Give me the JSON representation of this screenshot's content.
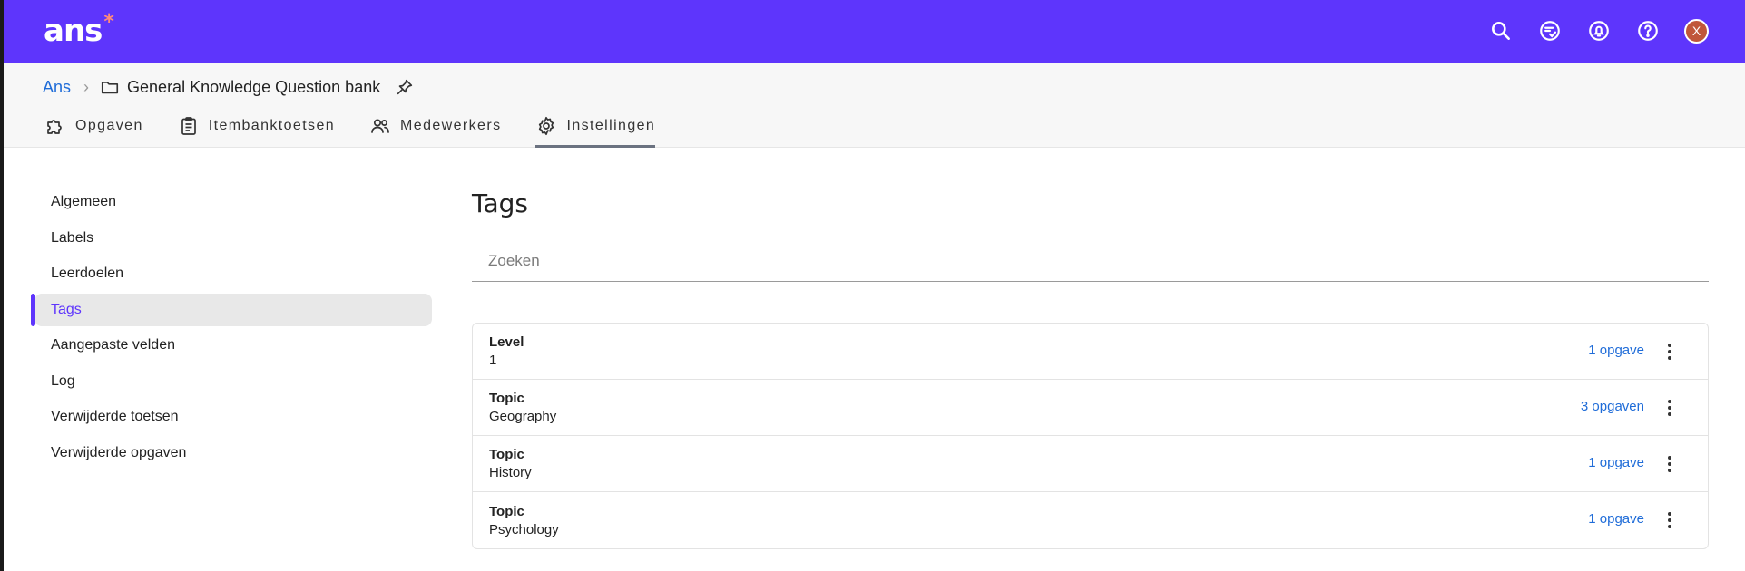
{
  "app": {
    "logo_text": "ans",
    "logo_star": "*",
    "avatar_initial": "X"
  },
  "icons": {
    "top": [
      "search-icon",
      "feedback-icon",
      "notification-icon",
      "help-icon"
    ],
    "tabs": [
      "puzzle-icon",
      "clipboard-icon",
      "people-icon",
      "gear-icon"
    ]
  },
  "breadcrumb": {
    "root": "Ans",
    "title": "General Knowledge Question bank"
  },
  "tabs": [
    {
      "label": "Opgaven",
      "icon": "puzzle-icon"
    },
    {
      "label": "Itembanktoetsen",
      "icon": "clipboard-icon"
    },
    {
      "label": "Medewerkers",
      "icon": "people-icon"
    },
    {
      "label": "Instellingen",
      "icon": "gear-icon",
      "active": true
    }
  ],
  "sidebar": {
    "items": [
      {
        "label": "Algemeen"
      },
      {
        "label": "Labels"
      },
      {
        "label": "Leerdoelen"
      },
      {
        "label": "Tags",
        "active": true
      },
      {
        "label": "Aangepaste velden"
      },
      {
        "label": "Log"
      },
      {
        "label": "Verwijderde toetsen"
      },
      {
        "label": "Verwijderde opgaven"
      }
    ]
  },
  "main": {
    "title": "Tags",
    "search_placeholder": "Zoeken",
    "tags": [
      {
        "key": "Level",
        "value": "1",
        "count": "1 opgave"
      },
      {
        "key": "Topic",
        "value": "Geography",
        "count": "3 opgaven"
      },
      {
        "key": "Topic",
        "value": "History",
        "count": "1 opgave"
      },
      {
        "key": "Topic",
        "value": "Psychology",
        "count": "1 opgave"
      }
    ]
  },
  "colors": {
    "brand": "#5e35fc",
    "link": "#1f6cd8",
    "avatar": "#c0563a"
  }
}
